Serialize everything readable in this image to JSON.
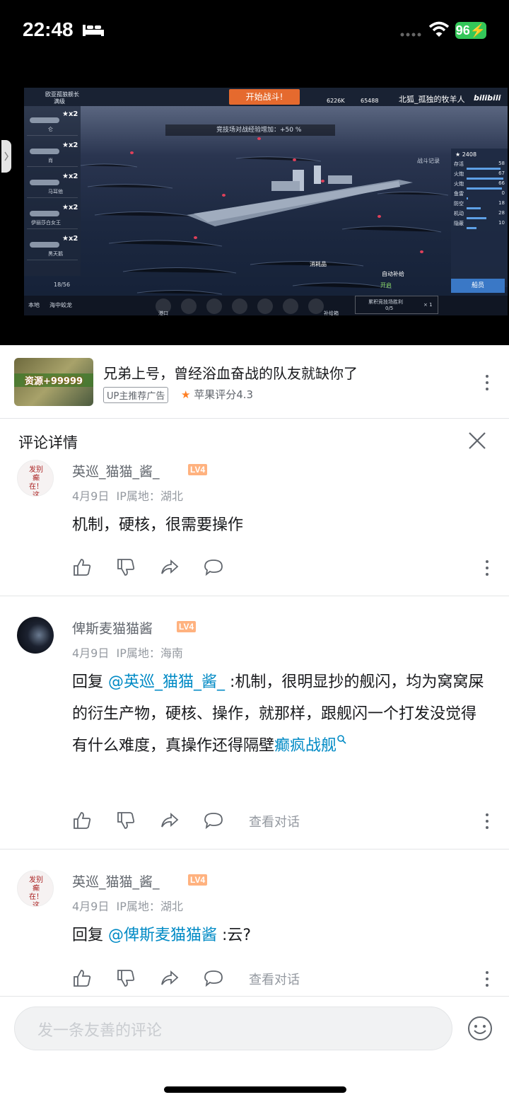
{
  "status_bar": {
    "time": "22:48",
    "battery": "96"
  },
  "game": {
    "player_name": "欧亚孤狼舰长",
    "player_sub": "满级",
    "start_battle": "开始战斗!",
    "res_gold": "6226K",
    "res_star": "65488",
    "title_overlay": "北狐_孤独的牧羊人",
    "logo": "bilibili",
    "bonus": "竞技场对战经验增加：+50 %",
    "battle_record": "战斗记录",
    "ship_list": [
      {
        "count": "★x2",
        "name": "仑"
      },
      {
        "count": "★x2",
        "name": "肖"
      },
      {
        "count": "★x2",
        "name": "马耳他"
      },
      {
        "count": "★x2",
        "name": "伊丽莎白女王"
      },
      {
        "count": "★x2",
        "name": "黑天鹅"
      }
    ],
    "list_count": "18/56",
    "local": "本地",
    "local_name": "海中蛟龙",
    "power": "2408",
    "stats": [
      {
        "k": "存活",
        "v": "58"
      },
      {
        "k": "火炮",
        "v": "67"
      },
      {
        "k": "火炮",
        "v": "66"
      },
      {
        "k": "鱼雷",
        "v": "0"
      },
      {
        "k": "防空",
        "v": "18"
      },
      {
        "k": "机动",
        "v": "28"
      },
      {
        "k": "隐蔽",
        "v": "10"
      }
    ],
    "crew": "船员",
    "consumables": "消耗品",
    "auto_refill": "自动补给",
    "auto_on": "开启",
    "arena_label": "累积竞技场胜利",
    "arena_value": "0/5",
    "arena_mult": "× 1",
    "bottom_labels": [
      "港口",
      "补给箱"
    ]
  },
  "ad": {
    "thumb_text": "资源+99999",
    "title": "兄弟上号，曾经浴血奋战的队友就缺你了",
    "tag": "UP主推荐广告",
    "rating": "苹果评分4.3"
  },
  "panel": {
    "title": "评论详情"
  },
  "comments": [
    {
      "avatar_text": "发别癫在！这",
      "user": "英巡_猫猫_酱_",
      "level": "LV4",
      "date": "4月9日",
      "ip": "IP属地：湖北",
      "text": "机制，硬核，很需要操作"
    },
    {
      "user": "俾斯麦猫猫酱",
      "level": "LV4",
      "date": "4月9日",
      "ip": "IP属地：海南",
      "reply_prefix": "回复 ",
      "mention": "@英巡_猫猫_酱_",
      "text": " :机制，很明显抄的舰闪，均为窝窝屎的衍生产物，硬核、操作，就那样，跟舰闪一个打发没觉得有什么难度，真操作还得隔壁",
      "keyword": "癫疯战舰",
      "view_conversation": "查看对话"
    },
    {
      "avatar_text": "发别癫在！这",
      "user": "英巡_猫猫_酱_",
      "level": "LV4",
      "date": "4月9日",
      "ip": "IP属地：湖北",
      "reply_prefix": "回复 ",
      "mention": "@俾斯麦猫猫酱",
      "text": " :云?",
      "view_conversation": "查看对话"
    }
  ],
  "input": {
    "placeholder": "发一条友善的评论"
  }
}
